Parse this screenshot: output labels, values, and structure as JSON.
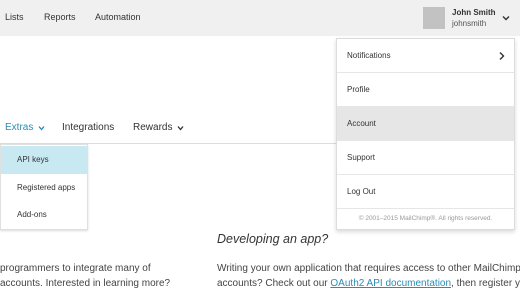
{
  "topnav": {
    "items": [
      {
        "label": "Lists"
      },
      {
        "label": "Reports"
      },
      {
        "label": "Automation"
      }
    ]
  },
  "user": {
    "name": "John Smith",
    "username": "johnsmith",
    "icon": "chevron-down-icon"
  },
  "subnav": {
    "items": [
      {
        "label": "Extras",
        "active": true
      },
      {
        "label": "Integrations"
      },
      {
        "label": "Rewards"
      }
    ]
  },
  "extras_menu": {
    "items": [
      {
        "label": "API keys",
        "active": true
      },
      {
        "label": "Registered apps"
      },
      {
        "label": "Add-ons"
      }
    ]
  },
  "account_menu": {
    "items": [
      {
        "label": "Notifications",
        "icon": "chevron-right-icon"
      },
      {
        "label": "Profile"
      },
      {
        "label": "Account",
        "active": true
      },
      {
        "label": "Support"
      },
      {
        "label": "Log Out"
      }
    ],
    "copyright": "© 2001–2015 MailChimp®. All rights reserved."
  },
  "content": {
    "heading": "Developing an app?",
    "left_line1": "programmers to integrate many of",
    "left_line2": "accounts. Interested in learning more?",
    "right_line1": "Writing your own application that requires access to other MailChimp us",
    "right_line2_pre": "accounts? Check out our ",
    "right_line2_link": "OAuth2 API documentation",
    "right_line2_post": ", then register your"
  },
  "colors": {
    "accent": "#2a8cb5",
    "topbar_bg": "#f0f0f0",
    "active_menu_bg": "#e6e6e6",
    "active_extras_bg": "#c8e8f2"
  }
}
